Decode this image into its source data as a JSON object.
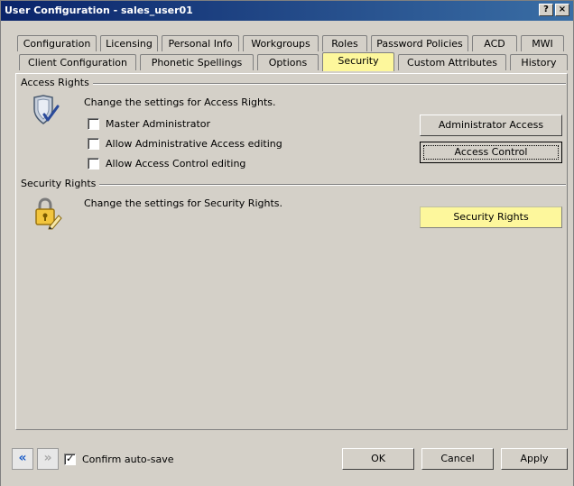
{
  "window": {
    "title": "User Configuration - sales_user01",
    "help_btn": "?",
    "close_btn": "×"
  },
  "tabs_row1": [
    {
      "label": "Configuration"
    },
    {
      "label": "Licensing"
    },
    {
      "label": "Personal Info"
    },
    {
      "label": "Workgroups"
    },
    {
      "label": "Roles"
    },
    {
      "label": "Password Policies"
    },
    {
      "label": "ACD"
    },
    {
      "label": "MWI"
    }
  ],
  "tabs_row2": [
    {
      "label": "Client Configuration"
    },
    {
      "label": "Phonetic Spellings"
    },
    {
      "label": "Options"
    },
    {
      "label": "Security"
    },
    {
      "label": "Custom Attributes"
    },
    {
      "label": "History"
    }
  ],
  "access_rights": {
    "group_label": "Access Rights",
    "description": "Change the settings for Access Rights.",
    "checkboxes": [
      {
        "label": "Master Administrator",
        "checked": false
      },
      {
        "label": "Allow Administrative Access editing",
        "checked": false
      },
      {
        "label": "Allow Access Control editing",
        "checked": false
      }
    ],
    "admin_access_button": "Administrator Access",
    "access_control_button": "Access Control"
  },
  "security_rights": {
    "group_label": "Security Rights",
    "description": "Change the settings for Security Rights.",
    "button": "Security Rights"
  },
  "footer": {
    "back_icon": "«",
    "forward_icon": "»",
    "confirm_autosave": "Confirm auto-save",
    "confirm_checked": "✓",
    "ok": "OK",
    "cancel": "Cancel",
    "apply": "Apply"
  },
  "colors": {
    "active_tab": "#fdf79c",
    "title_bar": "#0a246a",
    "highlight_button": "#fdf79c"
  }
}
